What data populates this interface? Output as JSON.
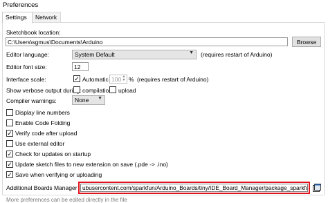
{
  "window": {
    "title": "Preferences"
  },
  "tabs": [
    {
      "label": "Settings"
    },
    {
      "label": "Network"
    }
  ],
  "sketchbook": {
    "label": "Sketchbook location:",
    "value": "C:\\Users\\sgmus\\Documents\\Arduino",
    "browse_label": "Browse"
  },
  "editor_language": {
    "label": "Editor language:",
    "value": "System Default",
    "note": "(requires restart of Arduino)"
  },
  "font_size": {
    "label": "Editor font size:",
    "value": "12"
  },
  "interface_scale": {
    "label": "Interface scale:",
    "automatic_label": "Automatic",
    "value": "100",
    "unit": "%",
    "note": "(requires restart of Arduino)",
    "automatic_checked": true
  },
  "verbose": {
    "label": "Show verbose output during:",
    "compilation_label": "compilation",
    "upload_label": "upload",
    "compilation_checked": false,
    "upload_checked": false
  },
  "compiler_warnings": {
    "label": "Compiler warnings:",
    "value": "None"
  },
  "options": [
    {
      "label": "Display line numbers",
      "checked": false
    },
    {
      "label": "Enable Code Folding",
      "checked": false
    },
    {
      "label": "Verify code after upload",
      "checked": true
    },
    {
      "label": "Use external editor",
      "checked": false
    },
    {
      "label": "Check for updates on startup",
      "checked": true
    },
    {
      "label": "Update sketch files to new extension on save (.pde -> .ino)",
      "checked": true
    },
    {
      "label": "Save when verifying or uploading",
      "checked": true
    }
  ],
  "boards_manager": {
    "label": "Additional Boards Manager URLs:",
    "value": "ubusercontent.com/sparkfun/Arduino_Boards/tiny/IDE_Board_Manager/package_sparkfun_index.json"
  },
  "footer": {
    "more_prefs": "More preferences can be edited directly in the file"
  },
  "colors": {
    "highlight": "#e0141e",
    "border": "#d9d9d9"
  }
}
